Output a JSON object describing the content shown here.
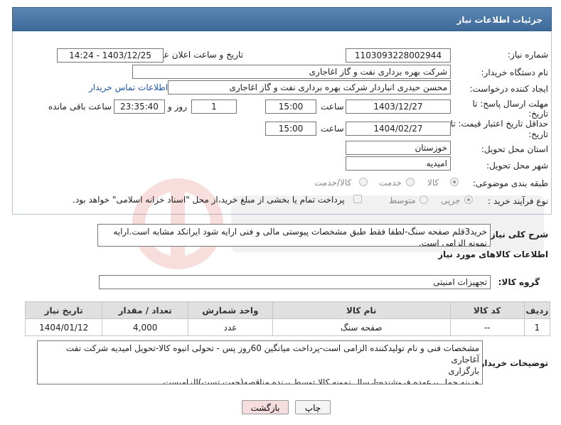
{
  "header": {
    "title": "جزئیات اطلاعات نیاز"
  },
  "form": {
    "need_number": {
      "label": "شماره نیاز:",
      "value": "1103093228002944"
    },
    "announce_date": {
      "label": "تاریخ و ساعت اعلان عمومی:",
      "value": "1403/12/25 - 14:24"
    },
    "buyer_org": {
      "label": "نام دستگاه خریدار:",
      "value": "شرکت بهره برداری نفت و گاز اغاجاری"
    },
    "requester": {
      "label": "ایجاد کننده درخواست:",
      "value": "محسن حیدری انباردار شرکت بهره برداری نفت و گاز اغاجاری",
      "contact_link": "اطلاعات تماس خریدار"
    },
    "deadline": {
      "label_line1": "مهلت ارسال پاسخ: تا",
      "label_line2": "تاریخ:",
      "date": "1403/12/27",
      "time_label": "ساعت",
      "time": "15:00",
      "days": "1",
      "days_label": "روز و",
      "remaining": "23:35:40",
      "remaining_label": "ساعت باقی مانده"
    },
    "validity": {
      "label_line1": "حداقل تاریخ اعتبار قیمت: تا",
      "label_line2": "تاریخ:",
      "date": "1404/02/27",
      "time_label": "ساعت",
      "time": "15:00"
    },
    "province": {
      "label": "استان محل تحویل:",
      "value": "خوزستان"
    },
    "city": {
      "label": "شهر محل تحویل:",
      "value": "امیدیه"
    },
    "category": {
      "label": "طبقه بندی موضوعی:",
      "options": [
        "کالا",
        "خدمت",
        "کالا/خدمت"
      ],
      "selected": "کالا"
    },
    "process": {
      "label": "نوع فرآیند خرید :",
      "options": [
        "جزیی",
        "متوسط"
      ],
      "selected": "جزیی",
      "payment_note": "پرداخت تمام یا بخشی از مبلغ خرید،از محل \"اسناد خزانه اسلامی\" خواهد بود."
    }
  },
  "description": {
    "label": "شرح کلی نیاز:",
    "text": "خرید3قلم صفحه سنگ-لطفا فقط طبق مشخصات پیوستی مالی و فنی ارایه شود ایرانکد مشابه است.ارایه نمونه الزامی است."
  },
  "goods": {
    "section_title": "اطلاعات کالاهای مورد نیاز",
    "group_label": "گروه کالا:",
    "group_value": "تجهیزات امنیتی",
    "columns": [
      "ردیف",
      "کد کالا",
      "نام کالا",
      "واحد شمارش",
      "تعداد / مقدار",
      "تاریخ نیاز"
    ],
    "rows": [
      [
        "1",
        "--",
        "صفحه سنگ",
        "عدد",
        "4,000",
        "1404/01/12"
      ]
    ]
  },
  "buyer_notes": {
    "label": "توضیحات خریدار:",
    "line1": "مشخصات فنی و نام تولیدکننده الزامی است-پرداخت میانگین 60روز پس - تحولی انبوه کالا-تحویل امیدیه شرکت نفت آغاجاری",
    "line2": "بارگزاری",
    "line3": "هزینه حمل برعهده فروشنده-ارسال نمونه کالا توسط برنده مناقصه(جهت تست)الزامیست"
  },
  "buttons": {
    "print": "چاپ",
    "back": "بازگشت"
  },
  "colors": {
    "title_bar": "#4a77a6",
    "link": "#1f55a8",
    "back_button": "#f7dede"
  }
}
